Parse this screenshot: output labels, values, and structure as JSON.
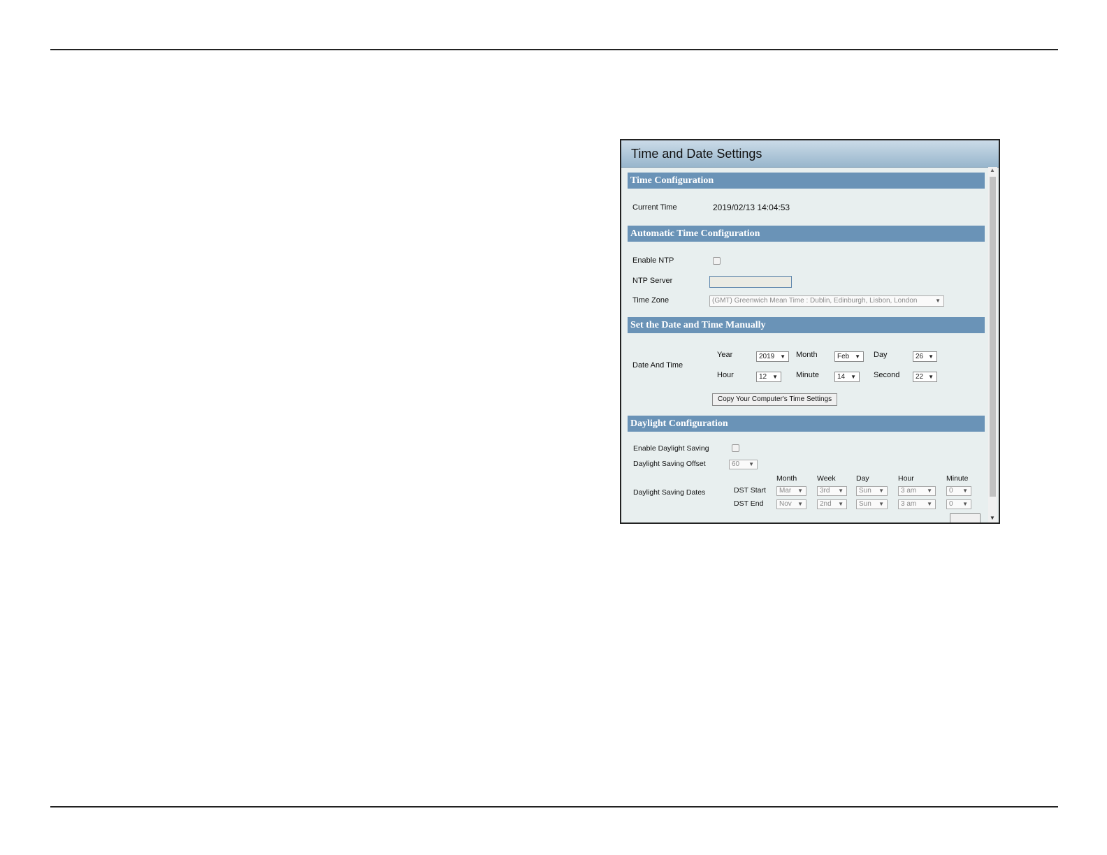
{
  "window": {
    "title": "Time and Date Settings"
  },
  "time_config": {
    "header": "Time Configuration",
    "current_time_label": "Current Time",
    "current_time_value": "2019/02/13 14:04:53"
  },
  "auto_config": {
    "header": "Automatic Time Configuration",
    "enable_ntp_label": "Enable NTP",
    "enable_ntp_checked": false,
    "ntp_server_label": "NTP Server",
    "ntp_server_value": "",
    "time_zone_label": "Time Zone",
    "time_zone_value": "(GMT) Greenwich Mean Time : Dublin, Edinburgh, Lisbon, London"
  },
  "manual": {
    "header": "Set the Date and Time Manually",
    "date_and_time_label": "Date And Time",
    "year_label": "Year",
    "year_value": "2019",
    "month_label": "Month",
    "month_value": "Feb",
    "day_label": "Day",
    "day_value": "26",
    "hour_label": "Hour",
    "hour_value": "12",
    "minute_label": "Minute",
    "minute_value": "14",
    "second_label": "Second",
    "second_value": "22",
    "copy_button": "Copy Your Computer's Time Settings"
  },
  "daylight": {
    "header": "Daylight Configuration",
    "enable_label": "Enable Daylight Saving",
    "enable_checked": false,
    "offset_label": "Daylight Saving Offset",
    "offset_value": "60",
    "dates_label": "Daylight Saving Dates",
    "columns": {
      "month": "Month",
      "week": "Week",
      "day": "Day",
      "hour": "Hour",
      "minute": "Minute"
    },
    "start": {
      "label": "DST Start",
      "month": "Mar",
      "week": "3rd",
      "day": "Sun",
      "hour": "3 am",
      "minute": "0"
    },
    "end": {
      "label": "DST End",
      "month": "Nov",
      "week": "2nd",
      "day": "Sun",
      "hour": "3 am",
      "minute": "0"
    }
  },
  "icons": {
    "dropdown": "▼",
    "scroll_up": "▲",
    "scroll_down": "▼"
  }
}
